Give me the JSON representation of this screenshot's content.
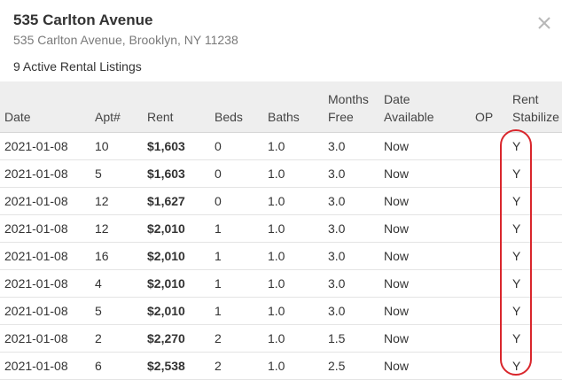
{
  "building": {
    "name": "535 Carlton Avenue",
    "address": "535 Carlton Avenue, Brooklyn, NY 11238",
    "listing_count": "9 Active Rental Listings"
  },
  "close_icon": "close-icon",
  "highlight_color": "#d9262c",
  "table": {
    "headers": {
      "date": "Date",
      "apt": "Apt#",
      "rent": "Rent",
      "beds": "Beds",
      "baths": "Baths",
      "months_free_1": "Months",
      "months_free_2": "Free",
      "date_available_1": "Date",
      "date_available_2": "Available",
      "op": "OP",
      "rent_stabilized_1": "Rent",
      "rent_stabilized_2": "Stabilize"
    },
    "rows": [
      {
        "date": "2021-01-08",
        "apt": "10",
        "rent": "$1,603",
        "beds": "0",
        "baths": "1.0",
        "months_free": "3.0",
        "date_available": "Now",
        "op": "",
        "stabilized": "Y"
      },
      {
        "date": "2021-01-08",
        "apt": "5",
        "rent": "$1,603",
        "beds": "0",
        "baths": "1.0",
        "months_free": "3.0",
        "date_available": "Now",
        "op": "",
        "stabilized": "Y"
      },
      {
        "date": "2021-01-08",
        "apt": "12",
        "rent": "$1,627",
        "beds": "0",
        "baths": "1.0",
        "months_free": "3.0",
        "date_available": "Now",
        "op": "",
        "stabilized": "Y"
      },
      {
        "date": "2021-01-08",
        "apt": "12",
        "rent": "$2,010",
        "beds": "1",
        "baths": "1.0",
        "months_free": "3.0",
        "date_available": "Now",
        "op": "",
        "stabilized": "Y"
      },
      {
        "date": "2021-01-08",
        "apt": "16",
        "rent": "$2,010",
        "beds": "1",
        "baths": "1.0",
        "months_free": "3.0",
        "date_available": "Now",
        "op": "",
        "stabilized": "Y"
      },
      {
        "date": "2021-01-08",
        "apt": "4",
        "rent": "$2,010",
        "beds": "1",
        "baths": "1.0",
        "months_free": "3.0",
        "date_available": "Now",
        "op": "",
        "stabilized": "Y"
      },
      {
        "date": "2021-01-08",
        "apt": "5",
        "rent": "$2,010",
        "beds": "1",
        "baths": "1.0",
        "months_free": "3.0",
        "date_available": "Now",
        "op": "",
        "stabilized": "Y"
      },
      {
        "date": "2021-01-08",
        "apt": "2",
        "rent": "$2,270",
        "beds": "2",
        "baths": "1.0",
        "months_free": "1.5",
        "date_available": "Now",
        "op": "",
        "stabilized": "Y"
      },
      {
        "date": "2021-01-08",
        "apt": "6",
        "rent": "$2,538",
        "beds": "2",
        "baths": "1.0",
        "months_free": "2.5",
        "date_available": "Now",
        "op": "",
        "stabilized": "Y"
      }
    ]
  }
}
